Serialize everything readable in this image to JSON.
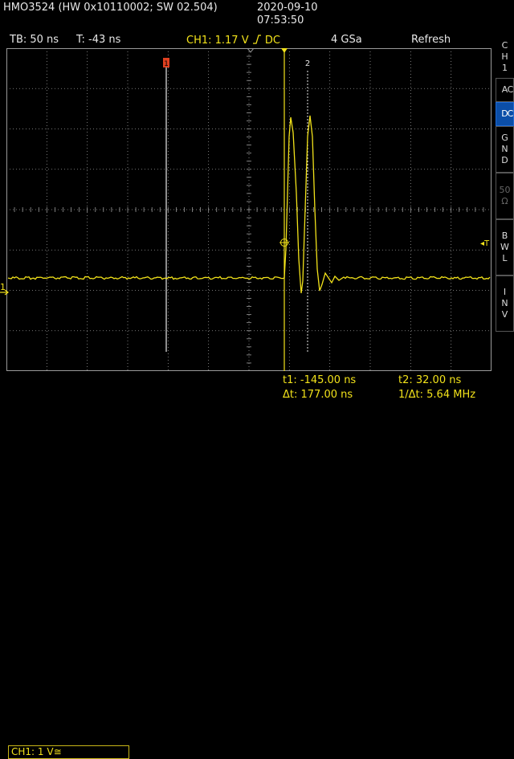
{
  "header": {
    "device": "HMO3524 (HW 0x10110002; SW 02.504)",
    "date": "2020-09-10",
    "time": "07:53:50"
  },
  "status": {
    "timebase": "TB: 50 ns",
    "trigger_time": "T: -43 ns",
    "channel": "CH1: 1.17 V",
    "coupling": "DC",
    "sample_rate": "4 GSa",
    "mode": "Refresh"
  },
  "sidebar": {
    "channel_title": [
      "C",
      "H",
      "1"
    ],
    "buttons": [
      {
        "label": [
          "A",
          "C"
        ],
        "state": "normal"
      },
      {
        "label": [
          "D",
          "C"
        ],
        "state": "active"
      },
      {
        "label": [
          "G",
          "N",
          "D"
        ],
        "state": "normal"
      },
      {
        "label": [
          "50",
          "Ω"
        ],
        "state": "disabled"
      },
      {
        "label": [
          "B",
          "W",
          "L"
        ],
        "state": "normal"
      },
      {
        "label": [
          "I",
          "N",
          "V"
        ],
        "state": "normal"
      }
    ]
  },
  "screen": {
    "cursor1_label": "1",
    "cursor2_label": "2",
    "trigger_marker": "T",
    "ch1_marker": "1",
    "colors": {
      "trace": "#f2e21a",
      "grid": "#9a9a9a",
      "cursor1": "#e04020"
    }
  },
  "measurements": {
    "ch1_scale": "CH1: 1 V",
    "ch1_coupling_symbol": "≅",
    "t1": "t1: -145.00 ns",
    "t2": "t2: 32.00 ns",
    "dt": "Δt: 177.00 ns",
    "inv_dt": "1/Δt: 5.64 MHz"
  }
}
